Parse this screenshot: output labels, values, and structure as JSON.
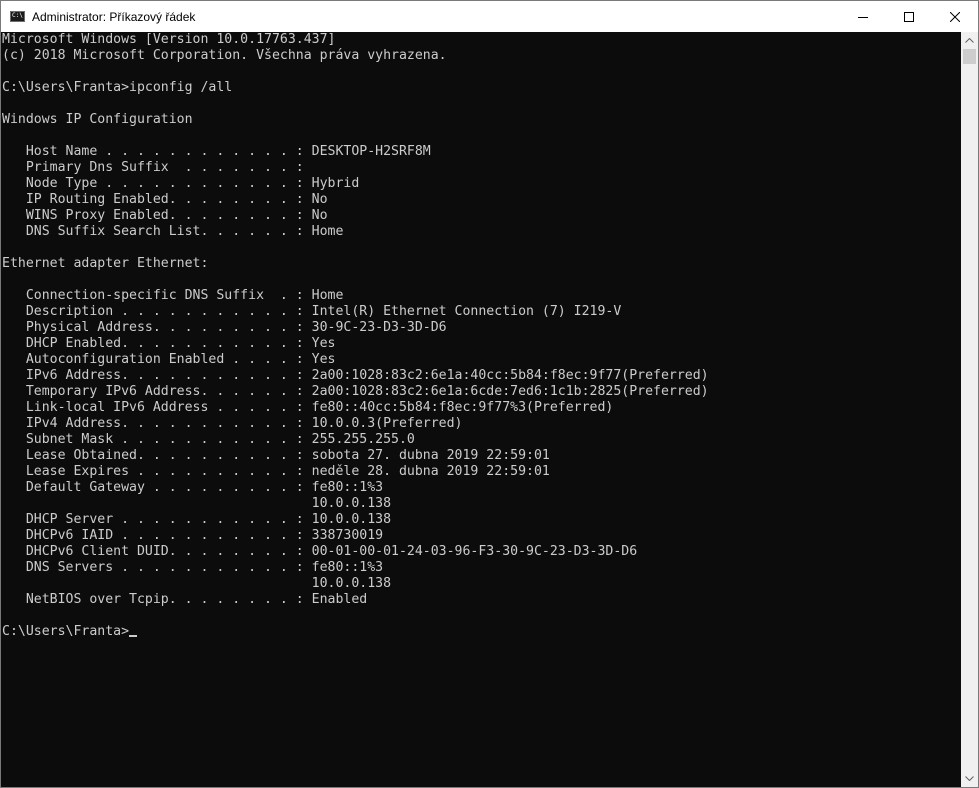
{
  "window": {
    "title": "Administrator: Příkazový řádek",
    "app_icon_text": "C:\\",
    "controls": {
      "minimize": "minimize-icon",
      "maximize": "maximize-icon",
      "close": "close-icon"
    }
  },
  "console": {
    "lines": [
      "Microsoft Windows [Version 10.0.17763.437]",
      "(c) 2018 Microsoft Corporation. Všechna práva vyhrazena.",
      "",
      "C:\\Users\\Franta>ipconfig /all",
      "",
      "Windows IP Configuration",
      "",
      "   Host Name . . . . . . . . . . . . : DESKTOP-H2SRF8M",
      "   Primary Dns Suffix  . . . . . . . :",
      "   Node Type . . . . . . . . . . . . : Hybrid",
      "   IP Routing Enabled. . . . . . . . : No",
      "   WINS Proxy Enabled. . . . . . . . : No",
      "   DNS Suffix Search List. . . . . . : Home",
      "",
      "Ethernet adapter Ethernet:",
      "",
      "   Connection-specific DNS Suffix  . : Home",
      "   Description . . . . . . . . . . . : Intel(R) Ethernet Connection (7) I219-V",
      "   Physical Address. . . . . . . . . : 30-9C-23-D3-3D-D6",
      "   DHCP Enabled. . . . . . . . . . . : Yes",
      "   Autoconfiguration Enabled . . . . : Yes",
      "   IPv6 Address. . . . . . . . . . . : 2a00:1028:83c2:6e1a:40cc:5b84:f8ec:9f77(Preferred)",
      "   Temporary IPv6 Address. . . . . . : 2a00:1028:83c2:6e1a:6cde:7ed6:1c1b:2825(Preferred)",
      "   Link-local IPv6 Address . . . . . : fe80::40cc:5b84:f8ec:9f77%3(Preferred)",
      "   IPv4 Address. . . . . . . . . . . : 10.0.0.3(Preferred)",
      "   Subnet Mask . . . . . . . . . . . : 255.255.255.0",
      "   Lease Obtained. . . . . . . . . . : sobota 27. dubna 2019 22:59:01",
      "   Lease Expires . . . . . . . . . . : neděle 28. dubna 2019 22:59:01",
      "   Default Gateway . . . . . . . . . : fe80::1%3",
      "                                       10.0.0.138",
      "   DHCP Server . . . . . . . . . . . : 10.0.0.138",
      "   DHCPv6 IAID . . . . . . . . . . . : 338730019",
      "   DHCPv6 Client DUID. . . . . . . . : 00-01-00-01-24-03-96-F3-30-9C-23-D3-3D-D6",
      "   DNS Servers . . . . . . . . . . . : fe80::1%3",
      "                                       10.0.0.138",
      "   NetBIOS over Tcpip. . . . . . . . : Enabled",
      "",
      "C:\\Users\\Franta>"
    ]
  },
  "scrollbar": {
    "up_icon": "scroll-up-arrow-icon",
    "down_icon": "scroll-down-arrow-icon"
  },
  "colors": {
    "console_bg": "#0c0c0c",
    "console_text": "#cccccc",
    "titlebar_bg": "#ffffff"
  }
}
